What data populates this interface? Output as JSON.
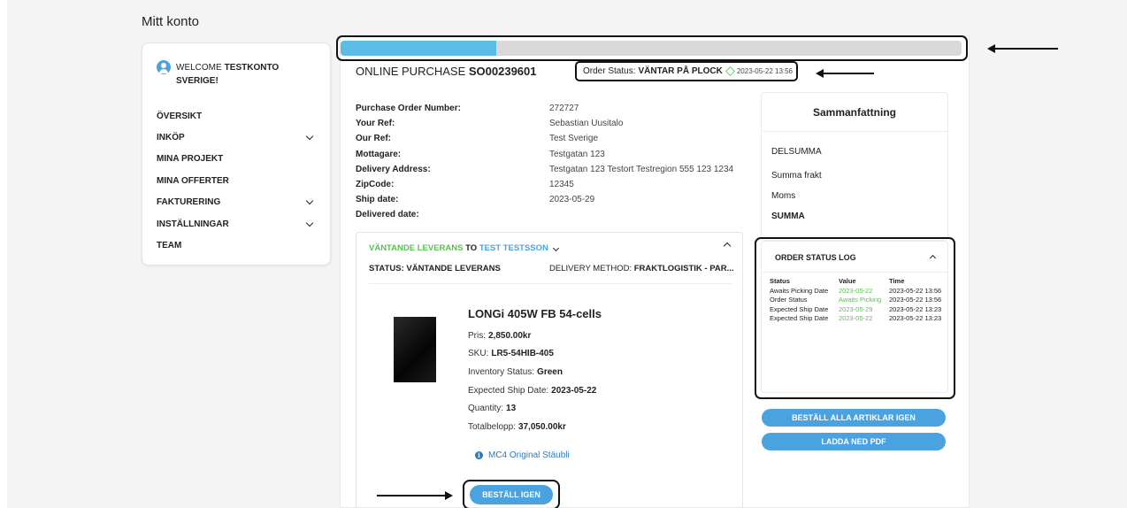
{
  "page": {
    "title": "Mitt konto"
  },
  "sidebar": {
    "welcome_prefix": "WELCOME",
    "welcome_name": "TESTKONTO SVERIGE!",
    "items": [
      {
        "label": "ÖVERSIKT",
        "expandable": false
      },
      {
        "label": "INKÖP",
        "expandable": true
      },
      {
        "label": "MINA PROJEKT",
        "expandable": false
      },
      {
        "label": "MINA OFFERTER",
        "expandable": false
      },
      {
        "label": "FAKTURERING",
        "expandable": true
      },
      {
        "label": "INSTÄLLNINGAR",
        "expandable": true
      },
      {
        "label": "TEAM",
        "expandable": false
      }
    ]
  },
  "progress": {
    "value_percent": 25,
    "fill_color": "#5bbce6",
    "track_color": "#d9d9d9"
  },
  "order": {
    "type_label": "ONLINE PURCHASE",
    "number": "SO00239601",
    "status_label": "Order Status:",
    "status_value": "VÄNTAR PÅ PLOCK",
    "status_date": "2023-05-22 13:56",
    "details": [
      {
        "label": "Purchase Order Number:",
        "value": "272727"
      },
      {
        "label": "Your Ref:",
        "value": "Sebastian Uusitalo"
      },
      {
        "label": "Our Ref:",
        "value": "Test Sverige"
      },
      {
        "label": "Mottagare:",
        "value": "Testgatan 123"
      },
      {
        "label": "Delivery Address:",
        "value": "Testgatan 123 Testort Testregion 555 123 1234"
      },
      {
        "label": "ZipCode:",
        "value": "12345"
      },
      {
        "label": "Ship date:",
        "value": "2023-05-29"
      },
      {
        "label": "Delivered date:",
        "value": ""
      }
    ]
  },
  "delivery": {
    "state": "VÄNTANDE LEVERANS",
    "to_word": "TO",
    "recipient": "TEST TESTSSON",
    "status_text": "STATUS: VÄNTANDE LEVERANS",
    "method_label": "DELIVERY METHOD:",
    "method_value": "FRAKTLOGISTIK - PAR...",
    "product": {
      "name": "LONGi 405W FB 54-cells",
      "price_label": "Pris:",
      "price": "2,850.00kr",
      "sku_label": "SKU:",
      "sku": "LR5-54HIB-405",
      "inventory_label": "Inventory Status:",
      "inventory": "Green",
      "ship_label": "Expected Ship Date:",
      "ship_date": "2023-05-22",
      "qty_label": "Quantity:",
      "qty": "13",
      "total_label": "Totalbelopp:",
      "total": "37,050.00kr",
      "accessory": "MC4 Original Stäubli"
    },
    "reorder_button": "BESTÄLL IGEN"
  },
  "summary": {
    "title": "Sammanfattning",
    "rows": [
      "DELSUMMA",
      "Summa frakt",
      "Moms",
      "SUMMA"
    ]
  },
  "status_log": {
    "title": "ORDER STATUS LOG",
    "headers": [
      "Status",
      "Value",
      "Time"
    ],
    "rows": [
      {
        "status": "Awaits Picking Date",
        "value": "2023-05-22",
        "time": "2023-05-22 13:56"
      },
      {
        "status": "Order Status",
        "value": "Awaits Picking",
        "time": "2023-05-22 13:56"
      },
      {
        "status": "Expected Ship Date",
        "value": "2023-05-29",
        "time": "2023-05-22 13:23"
      },
      {
        "status": "Expected Ship Date",
        "value": "2023-05-22",
        "time": "2023-05-22 13:23"
      }
    ]
  },
  "actions": {
    "reorder_all": "BESTÄLL ALLA ARTIKLAR IGEN",
    "download_pdf": "LADDA NED PDF"
  },
  "colors": {
    "accent": "#4aa3df",
    "success": "#57c24f",
    "link": "#2e7bb8"
  }
}
